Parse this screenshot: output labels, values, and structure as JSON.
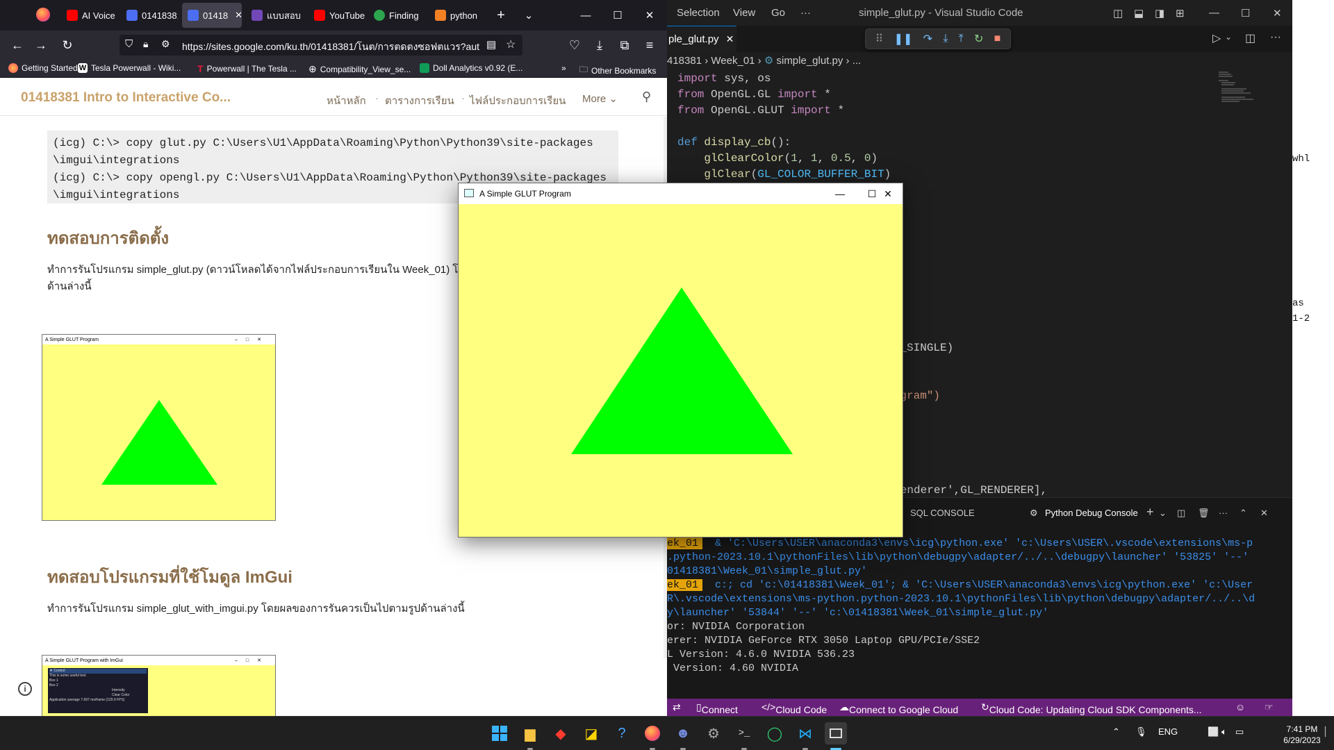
{
  "browser": {
    "tabs": [
      {
        "label": "AI Voice",
        "color": "#ff0000"
      },
      {
        "label": "01418381",
        "color": "#4c6ef5"
      },
      {
        "label": "01418",
        "color": "#4c6ef5"
      },
      {
        "label": "แบบสอบ",
        "color": "#7248b9"
      },
      {
        "label": "YouTube",
        "color": "#ff0000"
      },
      {
        "label": "Finding",
        "color": "#2da44e"
      },
      {
        "label": "python",
        "color": "#f48024"
      }
    ],
    "url": "https://sites.google.com/ku.th/01418381/โนต/การตดตงซอฟตแวร?aut",
    "url_host": "sites.google.com",
    "bookmarks": [
      {
        "label": "Getting Started"
      },
      {
        "label": "Tesla Powerwall - Wiki..."
      },
      {
        "label": "Powerwall | The Tesla ..."
      },
      {
        "label": "Compatibility_View_se..."
      },
      {
        "label": "Doll Analytics v0.92 (E..."
      }
    ],
    "other_bookmarks": "Other Bookmarks"
  },
  "site": {
    "title": "01418381 Intro to Interactive Co...",
    "nav": [
      "หน้าหลัก",
      "ตารางการเรียน",
      "ไฟล์ประกอบการเรียน",
      "More"
    ],
    "code_lines": [
      "(icg) C:\\> copy glut.py C:\\Users\\U1\\AppData\\Roaming\\Python\\Python39\\site-packages",
      "\\imgui\\integrations",
      "(icg) C:\\> copy opengl.py C:\\Users\\U1\\AppData\\Roaming\\Python\\Python39\\site-packages",
      "\\imgui\\integrations"
    ],
    "heading1": "ทดสอบการติดตั้ง",
    "para1": "ทำการรันโปรแกรม simple_glut.py (ดาวน์โหลดได้จากไฟล์ประกอบการเรียนใน Week_01) โดย",
    "para1b": "ด้านล่างนี้",
    "mini1_title": "A Simple GLUT Program",
    "heading2": "ทดสอบโปรแกรมที่ใช้โมดูล ImGui",
    "para2": "ทำการรันโปรแกรม simple_glut_with_imgui.py โดยผลของการรันควรเป็นไปตามรูปด้านล่างนี้",
    "mini2_title": "A Simple GLUT Program with ImGui",
    "mini2_panel": [
      "▼ Control",
      "This is some useful text.",
      "Box 1",
      "Box 2",
      "Intensity",
      "Clear Color",
      "Application average 7.697 ms/frame (129.9 FPS)"
    ]
  },
  "vscode": {
    "menu": [
      "Selection",
      "View",
      "Go",
      "···"
    ],
    "title": "simple_glut.py - Visual Studio Code",
    "tab": "ple_glut.py",
    "breadcrumb": [
      "418381",
      "Week_01",
      "simple_glut.py",
      "..."
    ],
    "code_visible_fragments": [
      "GLUT_SINGLE)",
      " Program\")",
      "['Renderer',GL_RENDERER],"
    ],
    "panel_tabs": [
      "SQL CONSOLE",
      "Python Debug Console"
    ],
    "terminal": [
      {
        "prompt": "ek_01",
        "text": "& 'C:\\Users\\USER\\anaconda3\\envs\\icg\\python.exe' 'c:\\Users\\USER\\.vscode\\extensions\\ms-p"
      },
      {
        "prompt": "",
        "text": ".python-2023.10.1\\pythonFiles\\lib\\python\\debugpy\\adapter/../..\\debugpy\\launcher' '53825' '--'"
      },
      {
        "prompt": "",
        "text": "01418381\\Week_01\\simple_glut.py'"
      },
      {
        "prompt": "ek_01",
        "text": "c:; cd 'c:\\01418381\\Week_01'; & 'C:\\Users\\USER\\anaconda3\\envs\\icg\\python.exe' 'c:\\User"
      },
      {
        "prompt": "",
        "text": "R\\.vscode\\extensions\\ms-python.python-2023.10.1\\pythonFiles\\lib\\python\\debugpy\\adapter/../..\\d"
      },
      {
        "prompt": "",
        "text": "y\\launcher' '53844' '--' 'c:\\01418381\\Week_01\\simple_glut.py'"
      },
      {
        "prompt": "",
        "text": "or: NVIDIA Corporation"
      },
      {
        "prompt": "",
        "text": "erer: NVIDIA GeForce RTX 3050 Laptop GPU/PCIe/SSE2"
      },
      {
        "prompt": "",
        "text": "L Version: 4.6.0 NVIDIA 536.23"
      },
      {
        "prompt": "",
        "text": " Version: 4.60 NVIDIA"
      }
    ],
    "status": [
      "Connect",
      "Cloud Code",
      "Connect to Google Cloud",
      "Cloud Code: Updating Cloud SDK Components..."
    ]
  },
  "right_window": {
    "fragments": [
      "whl",
      "as",
      "1-2"
    ]
  },
  "glut": {
    "title": "A Simple GLUT Program",
    "bg_color": "#ffff80",
    "triangle_color": "#00ff00"
  },
  "taskbar": {
    "icons": [
      "windows-start",
      "file-explorer",
      "app-red",
      "sticky-notes",
      "help",
      "firefox",
      "discord",
      "settings",
      "terminal",
      "app-green",
      "vscode",
      "app-active"
    ],
    "lang": "ENG",
    "time": "7:41 PM",
    "date": "6/29/2023"
  }
}
